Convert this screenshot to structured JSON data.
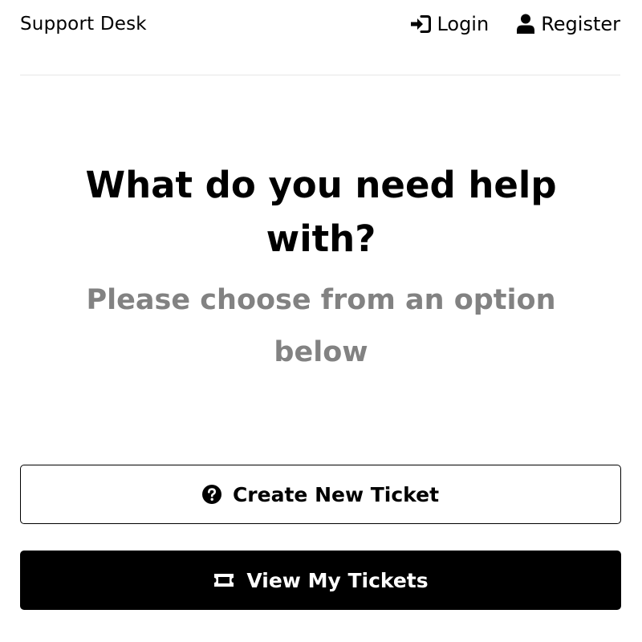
{
  "header": {
    "brand": "Support Desk",
    "nav": {
      "login_label": "Login",
      "login_icon": "sign-in-icon",
      "register_label": "Register",
      "register_icon": "user-icon"
    }
  },
  "hero": {
    "title": "What do you need help with?",
    "subtitle": "Please choose from an option below"
  },
  "actions": {
    "create_ticket_label": "Create New Ticket",
    "create_ticket_icon": "question-circle-icon",
    "view_tickets_label": "View My Tickets",
    "view_tickets_icon": "ticket-icon"
  },
  "colors": {
    "text": "#000000",
    "subtitle": "#828282",
    "primary_button_bg": "#000000",
    "primary_button_text": "#ffffff",
    "divider": "#e6e6e6"
  }
}
